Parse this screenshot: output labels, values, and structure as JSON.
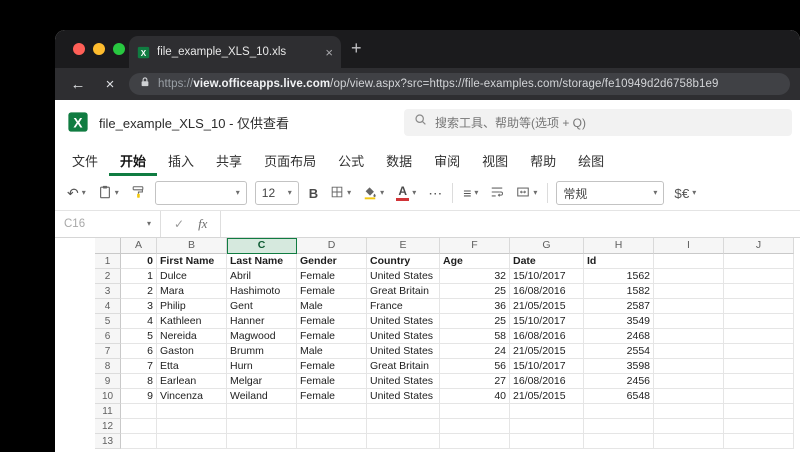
{
  "colors": {
    "accent": "#107c41",
    "selection_fill": "#d6e9de",
    "traffic_close": "#ff5f57",
    "traffic_min": "#febc2e",
    "traffic_zoom": "#28c840",
    "font_color_red": "#d13438",
    "fill_color_yellow": "#f2c80f"
  },
  "icons": {
    "chevron_down": "▾",
    "undo": "↶",
    "check": "✓",
    "back_arrow": "←",
    "close": "×",
    "new_tab": "+",
    "more": "⋯",
    "align_left": "≡",
    "excel_logo": "svg",
    "search": "svg",
    "lock": "svg",
    "paste_clipboard": "svg",
    "format_painter_brush": "svg",
    "borders_grid": "svg",
    "fill_bucket": "svg",
    "wrap_text": "svg",
    "merge_cells": "svg"
  },
  "browser": {
    "tab_title": "file_example_XLS_10.xls",
    "url_scheme": "https://",
    "url_domain": "view.officeapps.live.com",
    "url_path": "/op/view.aspx?src=https://file-examples.com/storage/fe10949d2d6758b1e9"
  },
  "app": {
    "doc_title": "file_example_XLS_10 - 仅供查看",
    "search_placeholder": "搜索工具、帮助等(选项 + Q)",
    "menu": [
      {
        "id": "file",
        "label": "文件"
      },
      {
        "id": "home",
        "label": "开始",
        "active": true
      },
      {
        "id": "insert",
        "label": "插入"
      },
      {
        "id": "share",
        "label": "共享"
      },
      {
        "id": "page-layout",
        "label": "页面布局"
      },
      {
        "id": "formulas",
        "label": "公式"
      },
      {
        "id": "data",
        "label": "数据"
      },
      {
        "id": "review",
        "label": "审阅"
      },
      {
        "id": "view",
        "label": "视图"
      },
      {
        "id": "help",
        "label": "帮助"
      },
      {
        "id": "draw",
        "label": "绘图"
      }
    ],
    "toolbar": {
      "font_size": "12",
      "bold": "B",
      "font_color_letter": "A",
      "number_format": "常规",
      "currency": "$€"
    },
    "formula_bar": {
      "name_box": "C16",
      "fx": "fx"
    }
  },
  "sheet": {
    "columns": [
      "A",
      "B",
      "C",
      "D",
      "E",
      "F",
      "G",
      "H",
      "I",
      "J"
    ],
    "selected_column": "C",
    "visible_rows": 13,
    "header_row": [
      "0",
      "First Name",
      "Last Name",
      "Gender",
      "Country",
      "Age",
      "Date",
      "Id"
    ],
    "data_rows": [
      [
        "1",
        "Dulce",
        "Abril",
        "Female",
        "United States",
        "32",
        "15/10/2017",
        "1562"
      ],
      [
        "2",
        "Mara",
        "Hashimoto",
        "Female",
        "Great Britain",
        "25",
        "16/08/2016",
        "1582"
      ],
      [
        "3",
        "Philip",
        "Gent",
        "Male",
        "France",
        "36",
        "21/05/2015",
        "2587"
      ],
      [
        "4",
        "Kathleen",
        "Hanner",
        "Female",
        "United States",
        "25",
        "15/10/2017",
        "3549"
      ],
      [
        "5",
        "Nereida",
        "Magwood",
        "Female",
        "United States",
        "58",
        "16/08/2016",
        "2468"
      ],
      [
        "6",
        "Gaston",
        "Brumm",
        "Male",
        "United States",
        "24",
        "21/05/2015",
        "2554"
      ],
      [
        "7",
        "Etta",
        "Hurn",
        "Female",
        "Great Britain",
        "56",
        "15/10/2017",
        "3598"
      ],
      [
        "8",
        "Earlean",
        "Melgar",
        "Female",
        "United States",
        "27",
        "16/08/2016",
        "2456"
      ],
      [
        "9",
        "Vincenza",
        "Weiland",
        "Female",
        "United States",
        "40",
        "21/05/2015",
        "6548"
      ]
    ]
  }
}
